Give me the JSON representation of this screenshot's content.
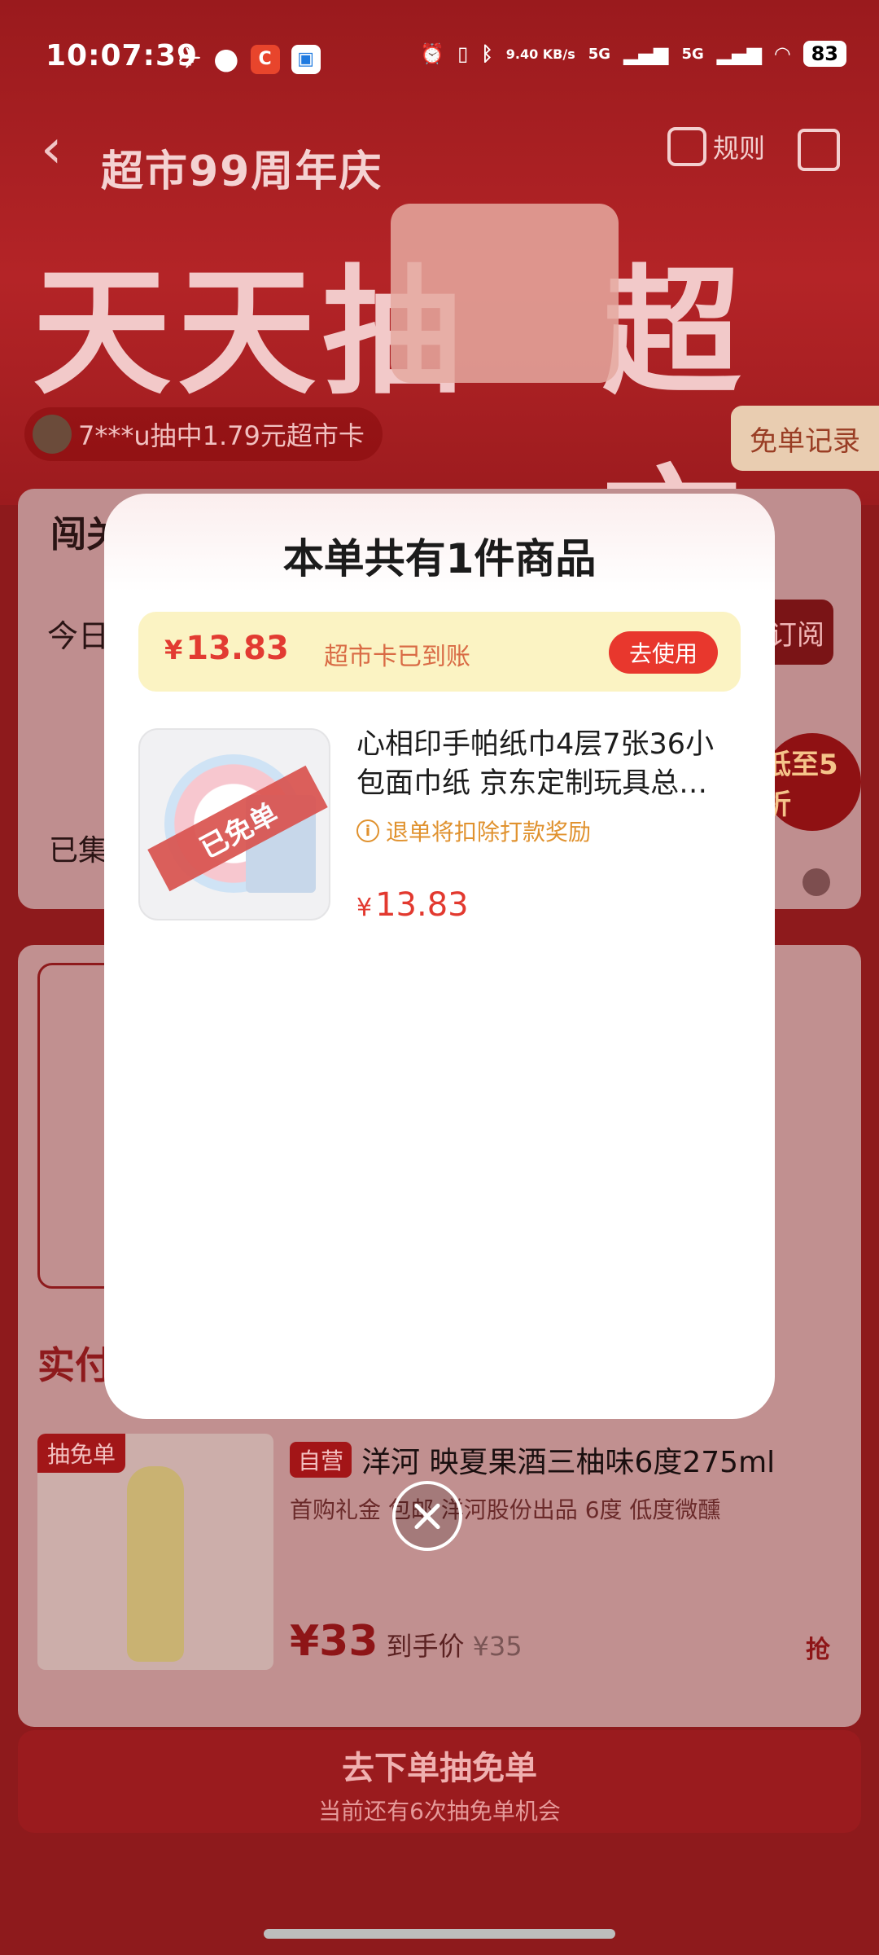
{
  "status_bar": {
    "time": "10:07:39",
    "network_speed": "9.40 KB/s",
    "signal1": "5G",
    "signal2": "5G",
    "battery": "83"
  },
  "header": {
    "back_icon": "back-chevron-icon",
    "title": "超市99周年庆",
    "rules_label": "规则",
    "share_icon": "share-icon"
  },
  "hero": {
    "left_text": "天天抽",
    "right_text": "超市卡",
    "ticker": "7***u抽中1.79元超市卡",
    "free_record_button": "免单记录"
  },
  "background": {
    "card1_heading": "闯关",
    "card1_today": "今日",
    "card1_collected": "已集",
    "card1_subscribe": "订阅",
    "card1_promo": "低至5折",
    "section_title": "实付",
    "product": {
      "tag": "抽免单",
      "self_label": "自营",
      "title": "洋河 映夏果酒三柚味6度275ml",
      "desc": "首购礼金 包邮 洋河股份出品 6度 低度微醺",
      "price": "¥33",
      "price_label": "到手价",
      "original_price": "¥35",
      "grab_label": "抢"
    },
    "bottom_button_title": "去下单抽免单",
    "bottom_button_sub": "当前还有6次抽免单机会"
  },
  "modal": {
    "title": "本单共有1件商品",
    "card": {
      "currency": "¥",
      "amount": "13.83",
      "status": "超市卡已到账",
      "use_button": "去使用"
    },
    "item": {
      "stamp": "已免单",
      "name_line1": "心相印手帕纸巾4层7张36小",
      "name_line2": "包面巾纸 京东定制玩具总…",
      "warning": "退单将扣除打款奖励",
      "currency": "¥",
      "price": "13.83"
    }
  },
  "colors": {
    "accent_red": "#e8372d",
    "background_red": "#8e1a1c",
    "warning_orange": "#e0922f",
    "card_yellow": "#fbf3c3"
  }
}
